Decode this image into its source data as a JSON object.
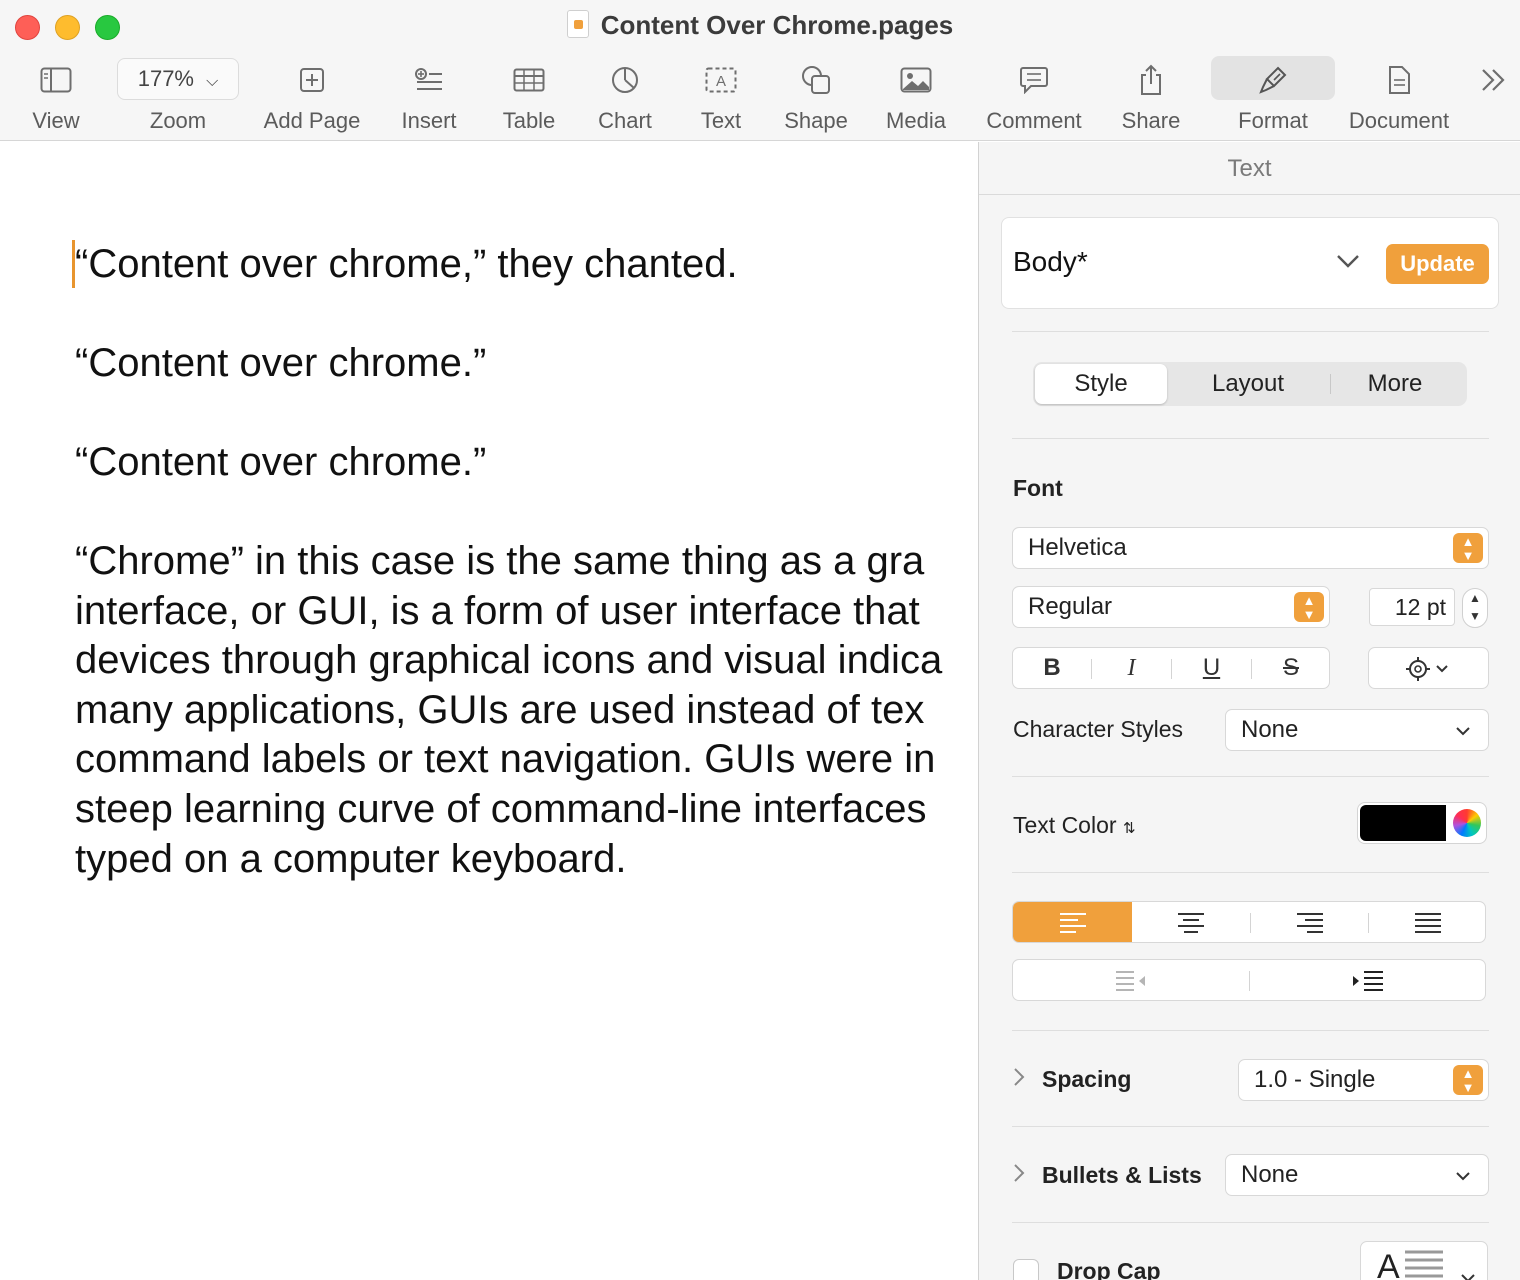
{
  "window": {
    "title": "Content Over Chrome.pages"
  },
  "toolbar": {
    "view_label": "View",
    "zoom_label": "Zoom",
    "zoom_value": "177%",
    "add_page_label": "Add Page",
    "insert_label": "Insert",
    "table_label": "Table",
    "chart_label": "Chart",
    "text_label": "Text",
    "shape_label": "Shape",
    "media_label": "Media",
    "comment_label": "Comment",
    "share_label": "Share",
    "format_label": "Format",
    "document_label": "Document",
    "overflow_icon": "chevron-double-right-icon"
  },
  "document": {
    "paragraphs": [
      "“Content over chrome,” they chanted.",
      "“Content over chrome.”",
      "“Content over chrome.”"
    ],
    "body_lines": [
      "“Chrome” in this case is the same thing as a gra",
      "interface, or GUI, is a form of user interface that",
      "devices through graphical icons and visual indica",
      "many applications, GUIs are used instead of tex",
      "command labels or text navigation. GUIs were in",
      "steep learning curve of command-line interfaces",
      "typed on a computer keyboard."
    ]
  },
  "inspector": {
    "header": "Text",
    "paragraph_style": "Body*",
    "update_label": "Update",
    "tabs": [
      "Style",
      "Layout",
      "More"
    ],
    "font_section_label": "Font",
    "font_family": "Helvetica",
    "font_typeface": "Regular",
    "font_size": "12 pt",
    "emphasis": {
      "bold": "B",
      "italic": "I",
      "underline": "U",
      "strikethrough": "S"
    },
    "character_styles_label": "Character Styles",
    "character_styles_value": "None",
    "text_color_label": "Text Color",
    "text_color": "#000000",
    "accent_color": "#f0a03c",
    "alignment_selected": "left",
    "spacing_label": "Spacing",
    "spacing_value": "1.0 - Single",
    "bullets_label": "Bullets & Lists",
    "bullets_value": "None",
    "drop_cap_label": "Drop Cap"
  }
}
